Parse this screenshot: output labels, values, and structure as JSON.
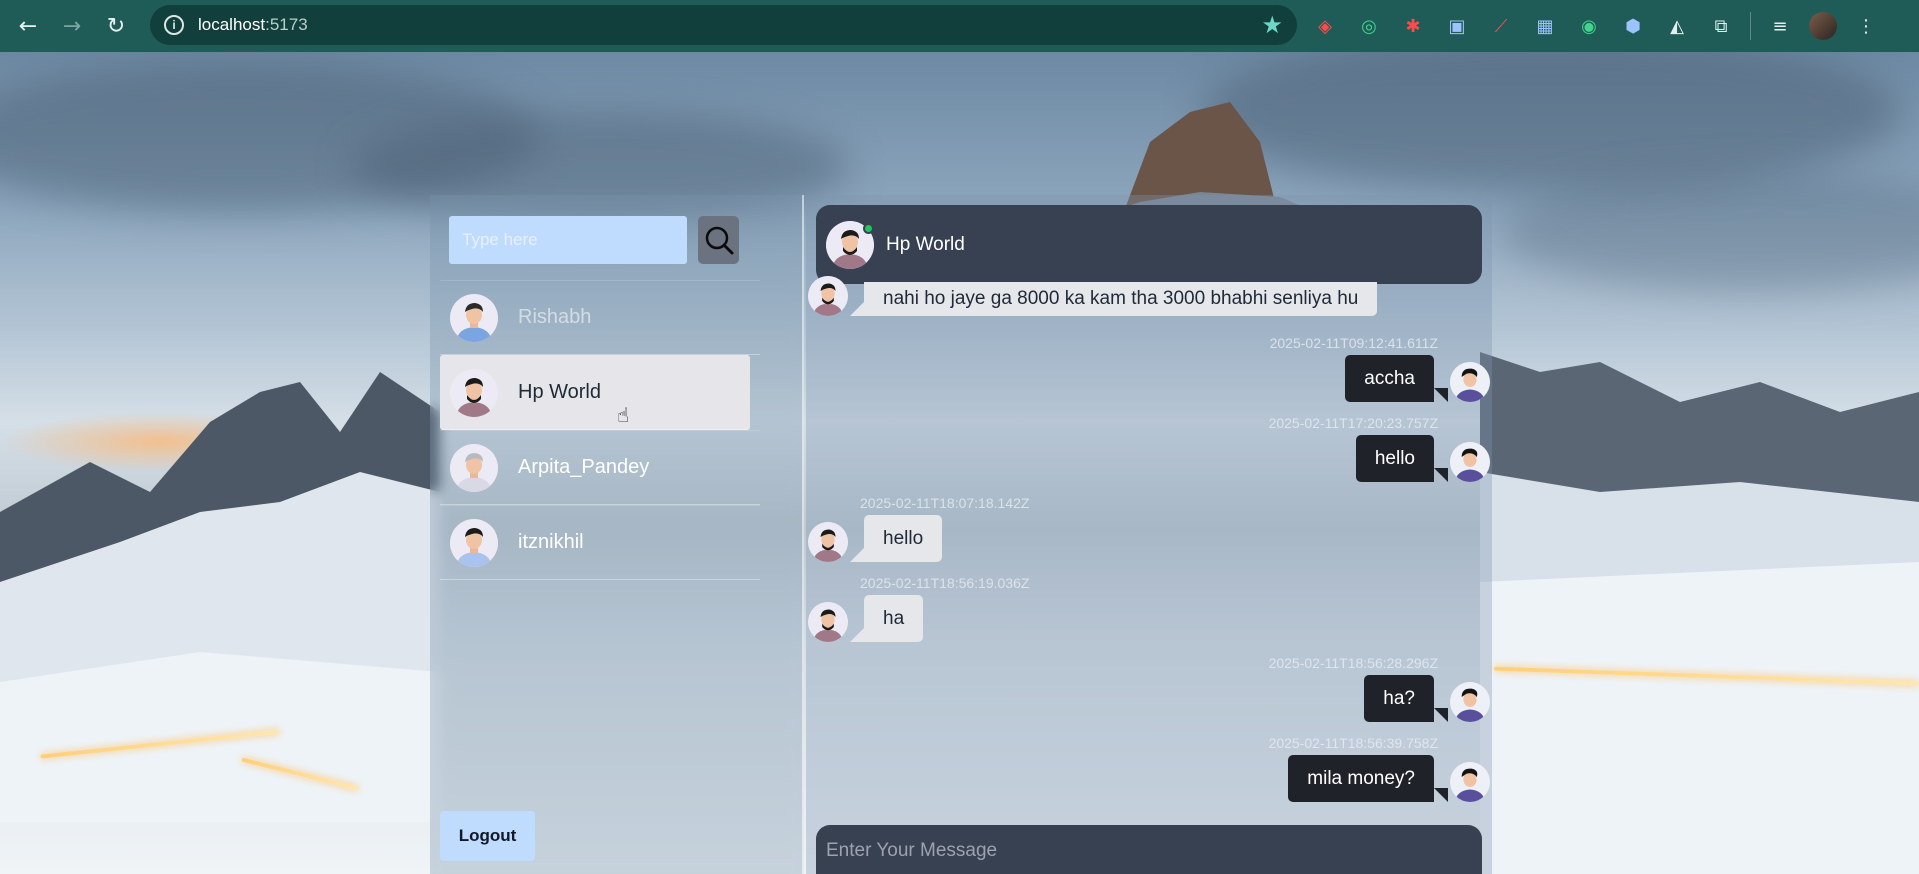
{
  "browser": {
    "url_host": "localhost",
    "url_port": ":5173",
    "nav": {
      "back_icon": "←",
      "forward_icon": "→",
      "reload_icon": "↻"
    },
    "extensions": [
      {
        "name": "ublock-icon",
        "glyph": "◈",
        "tone": "red"
      },
      {
        "name": "target-icon",
        "glyph": "◎",
        "tone": "green"
      },
      {
        "name": "puzzle-red-icon",
        "glyph": "✱",
        "tone": "red"
      },
      {
        "name": "window-icon",
        "glyph": "▣",
        "tone": "blue"
      },
      {
        "name": "slash-icon",
        "glyph": "⟋",
        "tone": "red"
      },
      {
        "name": "photo-icon",
        "glyph": "▦",
        "tone": "blue"
      },
      {
        "name": "eye-icon",
        "glyph": "◉",
        "tone": "green"
      },
      {
        "name": "hex-icon",
        "glyph": "⬢",
        "tone": "blue"
      },
      {
        "name": "triangle-icon",
        "glyph": "◭",
        "tone": ""
      },
      {
        "name": "extensions-icon",
        "glyph": "⧉",
        "tone": ""
      }
    ]
  },
  "sidebar": {
    "search_placeholder": "Type here",
    "users": [
      {
        "name": "Rishabh",
        "faded": true,
        "active": false,
        "avatar": "boy-hoodie"
      },
      {
        "name": "Hp World",
        "faded": false,
        "active": true,
        "avatar": "man-beard"
      },
      {
        "name": "Arpita_Pandey",
        "faded": false,
        "active": false,
        "avatar": "old-man"
      },
      {
        "name": "itznikhil",
        "faded": false,
        "active": false,
        "avatar": "man-glasses"
      }
    ],
    "logout_label": "Logout"
  },
  "chat": {
    "header_name": "Hp World",
    "online": true,
    "composer_placeholder": "Enter Your Message",
    "messages": [
      {
        "dir": "in",
        "text": "nahi ho jaye ga 8000 ka kam tha 3000 bhabhi senliya hu",
        "time": ""
      },
      {
        "dir": "out",
        "text": "accha",
        "time": "2025-02-11T09:12:41.611Z"
      },
      {
        "dir": "out",
        "text": "hello",
        "time": "2025-02-11T17:20:23.757Z"
      },
      {
        "dir": "in",
        "text": "hello",
        "time": "2025-02-11T18:07:18.142Z"
      },
      {
        "dir": "in",
        "text": "ha",
        "time": "2025-02-11T18:56:19.036Z"
      },
      {
        "dir": "out",
        "text": "ha?",
        "time": "2025-02-11T18:56:28.296Z"
      },
      {
        "dir": "out",
        "text": "mila money?",
        "time": "2025-02-11T18:56:39.758Z"
      }
    ]
  }
}
